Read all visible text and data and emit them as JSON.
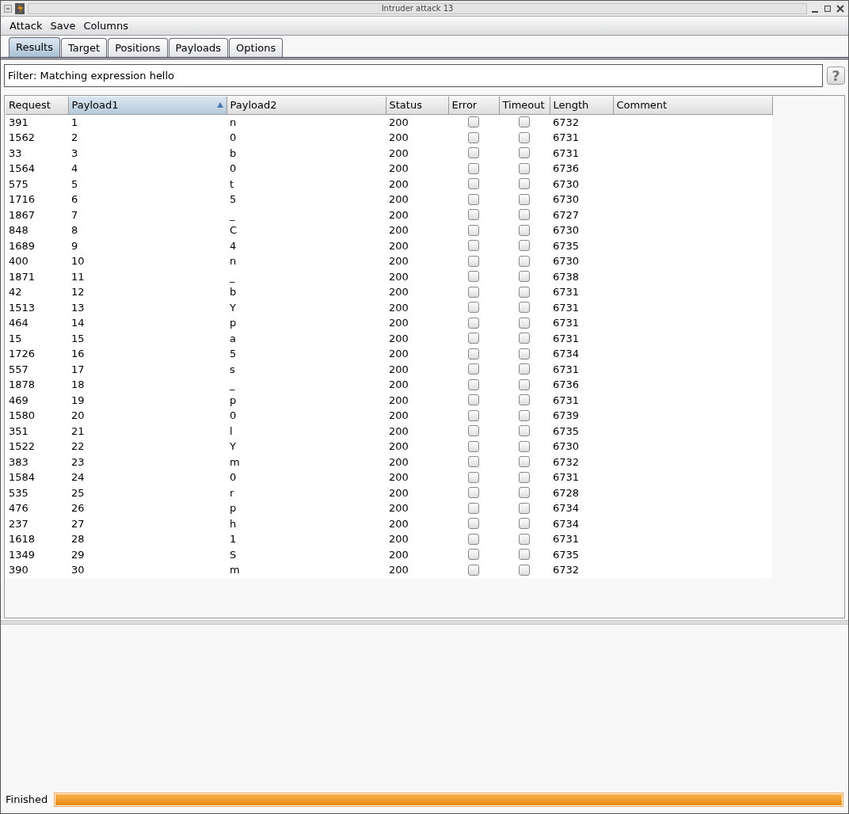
{
  "window": {
    "title": "Intruder attack 13"
  },
  "menu": [
    "Attack",
    "Save",
    "Columns"
  ],
  "tabs": [
    {
      "label": "Results",
      "selected": true
    },
    {
      "label": "Target",
      "selected": false
    },
    {
      "label": "Positions",
      "selected": false
    },
    {
      "label": "Payloads",
      "selected": false
    },
    {
      "label": "Options",
      "selected": false
    }
  ],
  "filter": {
    "value": "Filter: Matching expression hello",
    "help": "?"
  },
  "table": {
    "columns": [
      {
        "label": "Request",
        "sorted": false
      },
      {
        "label": "Payload1",
        "sorted": true
      },
      {
        "label": "Payload2",
        "sorted": false
      },
      {
        "label": "Status",
        "sorted": false
      },
      {
        "label": "Error",
        "sorted": false
      },
      {
        "label": "Timeout",
        "sorted": false
      },
      {
        "label": "Length",
        "sorted": false
      },
      {
        "label": "Comment",
        "sorted": false
      }
    ],
    "rows": [
      {
        "request": "391",
        "payload1": "1",
        "payload2": "n",
        "status": "200",
        "error": false,
        "timeout": false,
        "length": "6732"
      },
      {
        "request": "1562",
        "payload1": "2",
        "payload2": "0",
        "status": "200",
        "error": false,
        "timeout": false,
        "length": "6731"
      },
      {
        "request": "33",
        "payload1": "3",
        "payload2": "b",
        "status": "200",
        "error": false,
        "timeout": false,
        "length": "6731"
      },
      {
        "request": "1564",
        "payload1": "4",
        "payload2": "0",
        "status": "200",
        "error": false,
        "timeout": false,
        "length": "6736"
      },
      {
        "request": "575",
        "payload1": "5",
        "payload2": "t",
        "status": "200",
        "error": false,
        "timeout": false,
        "length": "6730"
      },
      {
        "request": "1716",
        "payload1": "6",
        "payload2": "5",
        "status": "200",
        "error": false,
        "timeout": false,
        "length": "6730"
      },
      {
        "request": "1867",
        "payload1": "7",
        "payload2": "_",
        "status": "200",
        "error": false,
        "timeout": false,
        "length": "6727"
      },
      {
        "request": "848",
        "payload1": "8",
        "payload2": "C",
        "status": "200",
        "error": false,
        "timeout": false,
        "length": "6730"
      },
      {
        "request": "1689",
        "payload1": "9",
        "payload2": "4",
        "status": "200",
        "error": false,
        "timeout": false,
        "length": "6735"
      },
      {
        "request": "400",
        "payload1": "10",
        "payload2": "n",
        "status": "200",
        "error": false,
        "timeout": false,
        "length": "6730"
      },
      {
        "request": "1871",
        "payload1": "11",
        "payload2": "_",
        "status": "200",
        "error": false,
        "timeout": false,
        "length": "6738"
      },
      {
        "request": "42",
        "payload1": "12",
        "payload2": "b",
        "status": "200",
        "error": false,
        "timeout": false,
        "length": "6731"
      },
      {
        "request": "1513",
        "payload1": "13",
        "payload2": "Y",
        "status": "200",
        "error": false,
        "timeout": false,
        "length": "6731"
      },
      {
        "request": "464",
        "payload1": "14",
        "payload2": "p",
        "status": "200",
        "error": false,
        "timeout": false,
        "length": "6731"
      },
      {
        "request": "15",
        "payload1": "15",
        "payload2": "a",
        "status": "200",
        "error": false,
        "timeout": false,
        "length": "6731"
      },
      {
        "request": "1726",
        "payload1": "16",
        "payload2": "5",
        "status": "200",
        "error": false,
        "timeout": false,
        "length": "6734"
      },
      {
        "request": "557",
        "payload1": "17",
        "payload2": "s",
        "status": "200",
        "error": false,
        "timeout": false,
        "length": "6731"
      },
      {
        "request": "1878",
        "payload1": "18",
        "payload2": "_",
        "status": "200",
        "error": false,
        "timeout": false,
        "length": "6736"
      },
      {
        "request": "469",
        "payload1": "19",
        "payload2": "p",
        "status": "200",
        "error": false,
        "timeout": false,
        "length": "6731"
      },
      {
        "request": "1580",
        "payload1": "20",
        "payload2": "0",
        "status": "200",
        "error": false,
        "timeout": false,
        "length": "6739"
      },
      {
        "request": "351",
        "payload1": "21",
        "payload2": "l",
        "status": "200",
        "error": false,
        "timeout": false,
        "length": "6735"
      },
      {
        "request": "1522",
        "payload1": "22",
        "payload2": "Y",
        "status": "200",
        "error": false,
        "timeout": false,
        "length": "6730"
      },
      {
        "request": "383",
        "payload1": "23",
        "payload2": "m",
        "status": "200",
        "error": false,
        "timeout": false,
        "length": "6732"
      },
      {
        "request": "1584",
        "payload1": "24",
        "payload2": "0",
        "status": "200",
        "error": false,
        "timeout": false,
        "length": "6731"
      },
      {
        "request": "535",
        "payload1": "25",
        "payload2": "r",
        "status": "200",
        "error": false,
        "timeout": false,
        "length": "6728"
      },
      {
        "request": "476",
        "payload1": "26",
        "payload2": "p",
        "status": "200",
        "error": false,
        "timeout": false,
        "length": "6734"
      },
      {
        "request": "237",
        "payload1": "27",
        "payload2": "h",
        "status": "200",
        "error": false,
        "timeout": false,
        "length": "6734"
      },
      {
        "request": "1618",
        "payload1": "28",
        "payload2": "1",
        "status": "200",
        "error": false,
        "timeout": false,
        "length": "6731"
      },
      {
        "request": "1349",
        "payload1": "29",
        "payload2": "S",
        "status": "200",
        "error": false,
        "timeout": false,
        "length": "6735"
      },
      {
        "request": "390",
        "payload1": "30",
        "payload2": "m",
        "status": "200",
        "error": false,
        "timeout": false,
        "length": "6732"
      }
    ]
  },
  "status_bar": {
    "text": "Finished",
    "level": 1
  }
}
